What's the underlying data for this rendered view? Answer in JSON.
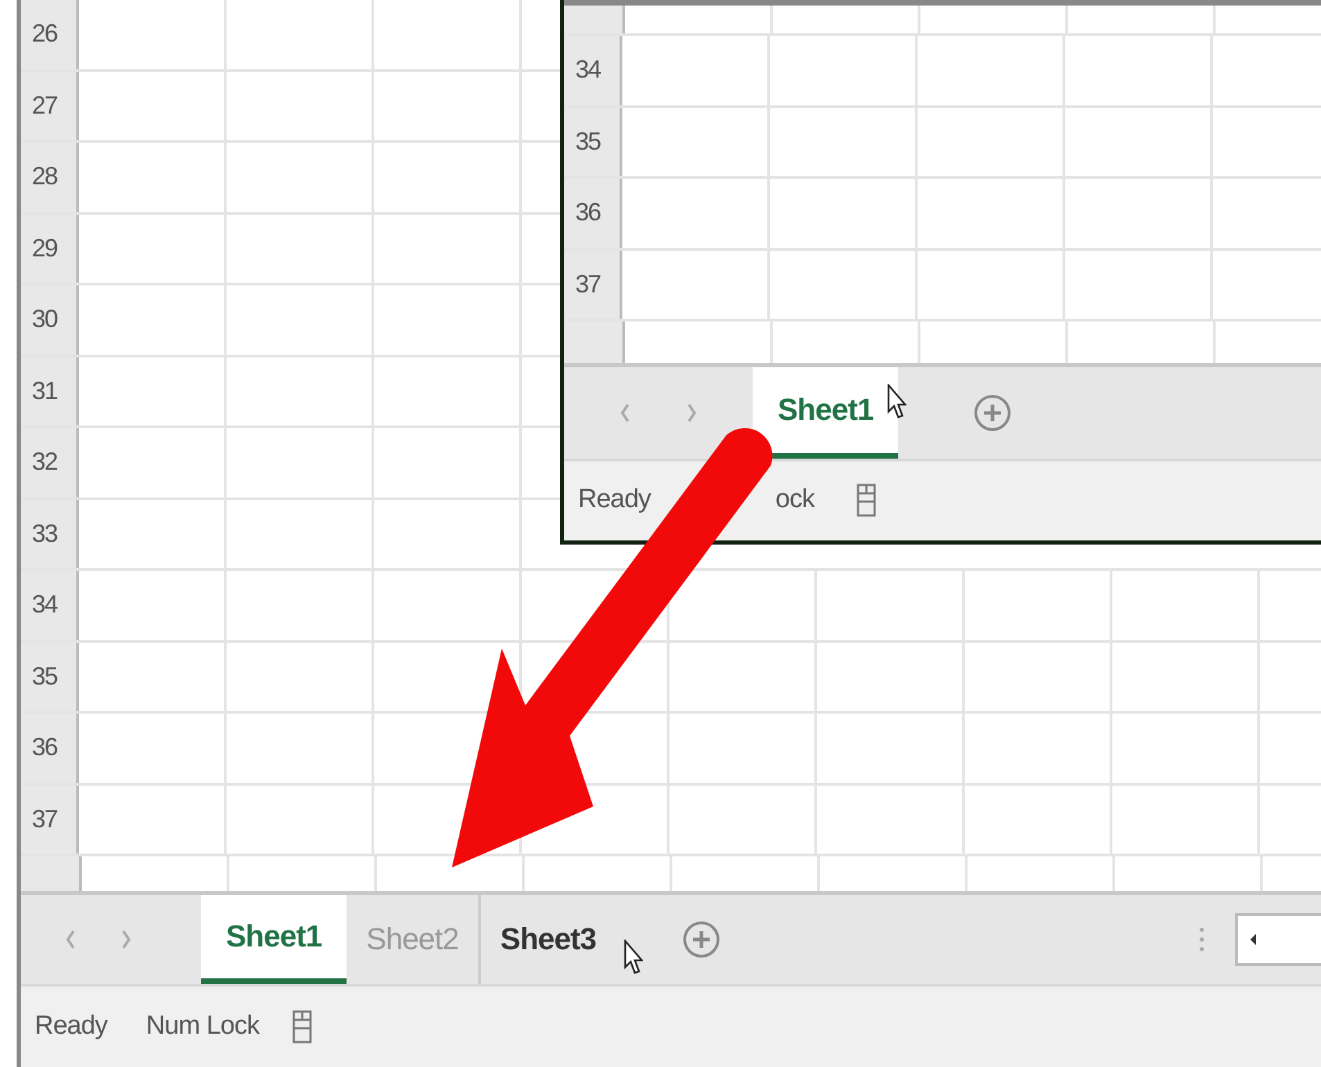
{
  "main": {
    "row_headers": [
      "26",
      "27",
      "28",
      "29",
      "30",
      "31",
      "32",
      "33",
      "34",
      "35",
      "36",
      "37"
    ],
    "sheet_tabs": [
      {
        "label": "Sheet1",
        "selected": true,
        "hovered": false
      },
      {
        "label": "Sheet2",
        "selected": false,
        "hovered": false
      },
      {
        "label": "Sheet3",
        "selected": false,
        "hovered": true
      }
    ],
    "status_bar": {
      "items": [
        "Ready",
        "Num Lock"
      ]
    }
  },
  "inset": {
    "row_headers": [
      "34",
      "35",
      "36",
      "37"
    ],
    "sheet_tabs": [
      {
        "label": "Sheet1",
        "selected": true,
        "hovered": false
      }
    ],
    "status_bar": {
      "items": [
        "Ready",
        "ock"
      ]
    }
  }
}
